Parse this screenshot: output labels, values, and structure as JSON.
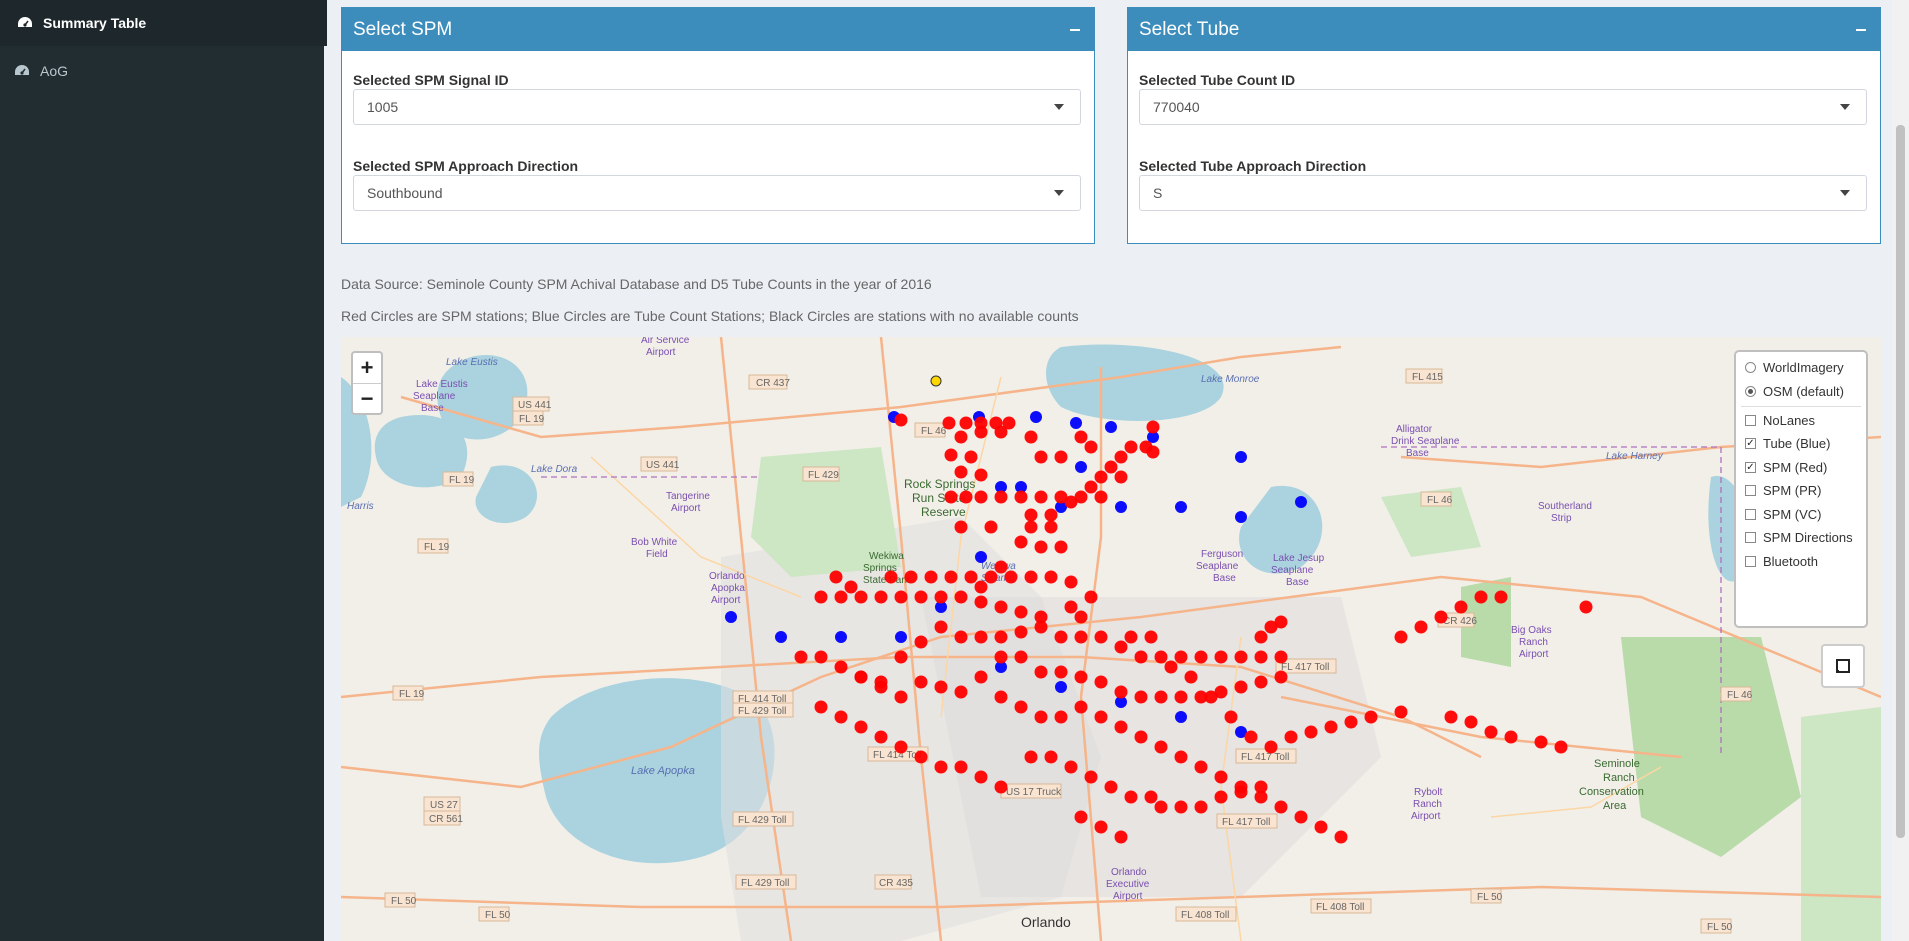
{
  "sidebar": {
    "items": [
      {
        "label": "Summary Table",
        "icon": "dashboard-icon",
        "active": true
      },
      {
        "label": "AoG",
        "icon": "dashboard-icon",
        "active": false
      }
    ]
  },
  "spm_box": {
    "title": "Select SPM",
    "signal_label": "Selected SPM Signal ID",
    "signal_value": "1005",
    "direction_label": "Selected SPM Approach Direction",
    "direction_value": "Southbound"
  },
  "tube_box": {
    "title": "Select Tube",
    "count_label": "Selected Tube Count ID",
    "count_value": "770040",
    "direction_label": "Selected Tube Approach Direction",
    "direction_value": "S"
  },
  "notes": {
    "source": "Data Source: Seminole County SPM Achival Database and D5 Tube Counts in the year of 2016",
    "legend": "Red Circles are SPM stations; Blue Circles are Tube Count Stations; Black Circles are stations with no available counts"
  },
  "map": {
    "zoom_in": "+",
    "zoom_out": "−",
    "base_layers": [
      {
        "label": "WorldImagery",
        "checked": false
      },
      {
        "label": "OSM (default)",
        "checked": true
      }
    ],
    "overlays": [
      {
        "label": "NoLanes",
        "checked": false
      },
      {
        "label": "Tube (Blue)",
        "checked": true
      },
      {
        "label": "SPM (Red)",
        "checked": true
      },
      {
        "label": "SPM (PR)",
        "checked": false
      },
      {
        "label": "SPM (VC)",
        "checked": false
      },
      {
        "label": "SPM Directions",
        "checked": false
      },
      {
        "label": "Bluetooth",
        "checked": false
      }
    ],
    "place_labels": [
      "Lake Eustis",
      "Lake Eustis Seaplane Base",
      "Air Service Airport",
      "CR 437",
      "US 441",
      "FL 19",
      "FL 415",
      "Lake Monroe",
      "Alligator Drink Seaplane Base",
      "FL 46",
      "US 441",
      "FL 429",
      "Lake Dora",
      "Rock Springs Run State Reserve",
      "Tangerine Airport",
      "Harris",
      "FL 19",
      "Bob White Field",
      "Wekiwa Springs State Park",
      "Wekiwa Swamp",
      "Orlando Apopka Airport",
      "FL 46",
      "Southerland Strip",
      "Lake Harney",
      "Ferguson Seaplane Base",
      "Lake Jesup Seaplane Base",
      "CR 426",
      "Big Oaks Ranch Airport",
      "FL 414 Toll",
      "FL 429 Toll",
      "FL 417 Toll",
      "FL 19",
      "Lake Apopka",
      "FL 414 Toll",
      "FL 417 Toll",
      "US 17 Truck",
      "US 27",
      "CR 561",
      "FL 429 Toll",
      "FL 417 Toll",
      "Rybolt Ranch Airport",
      "Seminole Ranch Conservation Area",
      "FL 429 Toll",
      "CR 435",
      "Orlando Executive Airport",
      "FL 50",
      "FL 50",
      "FL 408 Toll",
      "FL 408 Toll",
      "FL 50",
      "Orlando",
      "FL 46",
      "FL 50"
    ]
  }
}
